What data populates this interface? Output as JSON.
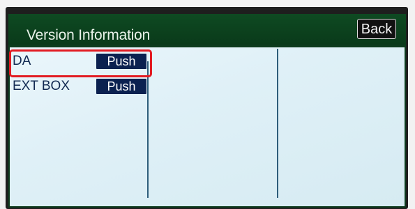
{
  "header": {
    "title": "Version Information",
    "back_label": "Back"
  },
  "rows": [
    {
      "label": "DA",
      "button_label": "Push"
    },
    {
      "label": "EXT BOX",
      "button_label": "Push"
    }
  ],
  "colors": {
    "header_bg": "#0e4a22",
    "content_bg": "#e3f3f9",
    "button_bg": "#0b2150",
    "highlight": "#e21b22"
  }
}
